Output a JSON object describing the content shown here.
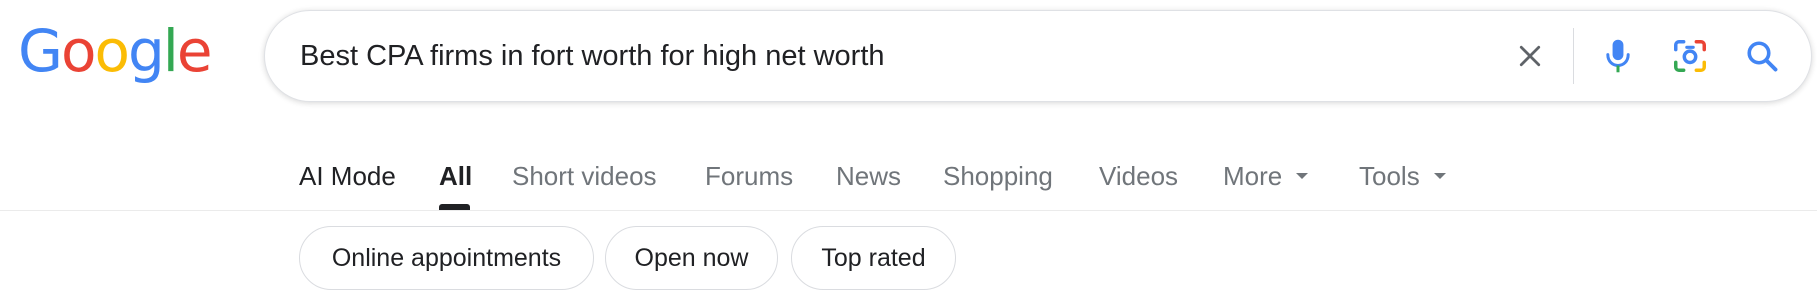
{
  "logo": {
    "letters": [
      "G",
      "o",
      "o",
      "g",
      "l",
      "e"
    ],
    "colors": [
      "#4285F4",
      "#EA4335",
      "#FBBC05",
      "#4285F4",
      "#34A853",
      "#EA4335"
    ]
  },
  "search": {
    "query": "Best CPA firms in fort worth for high net worth",
    "icons": [
      "clear-icon",
      "microphone-icon",
      "lens-icon",
      "search-icon"
    ]
  },
  "tabs": [
    {
      "label": "AI Mode"
    },
    {
      "label": "All",
      "active": true
    },
    {
      "label": "Short videos"
    },
    {
      "label": "Forums"
    },
    {
      "label": "News"
    },
    {
      "label": "Shopping"
    },
    {
      "label": "Videos"
    },
    {
      "label": "More"
    },
    {
      "label": "Tools"
    }
  ],
  "chips": [
    {
      "label": "Online appointments"
    },
    {
      "label": "Open now"
    },
    {
      "label": "Top rated"
    }
  ],
  "colors": {
    "text_primary": "#202124",
    "text_secondary": "#70757a",
    "border": "#dadce0",
    "icon_blue": "#4285F4"
  }
}
